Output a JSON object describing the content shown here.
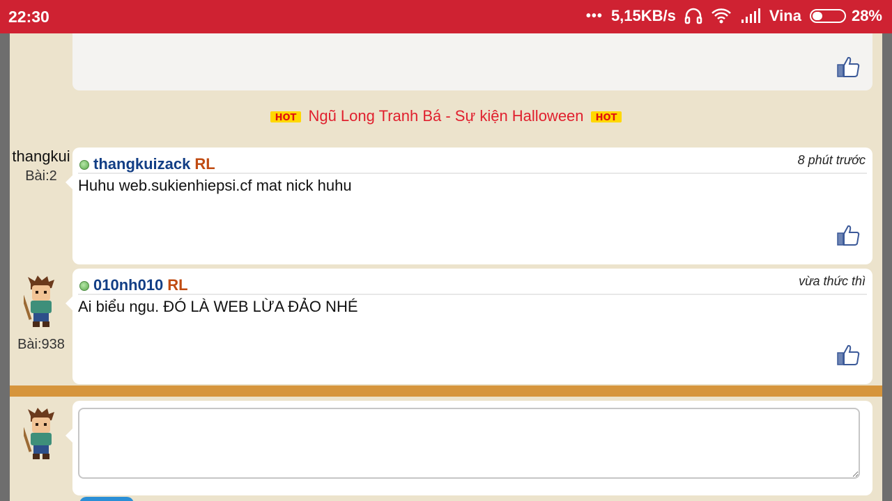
{
  "status_bar": {
    "time": "22:30",
    "network_speed": "5,15KB/s",
    "carrier": "Vina",
    "battery": "28%"
  },
  "hot_topic": {
    "badge": "HOT",
    "title": "Ngũ Long Tranh Bá - Sự kiện Halloween"
  },
  "posts": [
    {
      "author": "thangkuizack",
      "author_short": "thangkui",
      "post_count": "Bài:2",
      "role": "RL",
      "time": "8 phút trước",
      "content": "Huhu web.sukienhiepsi.cf mat nick huhu"
    },
    {
      "author": "010nh010",
      "post_count": "Bài:938",
      "role": "RL",
      "time": "vừa thức thì",
      "content": "Ai biểu ngu. ĐÓ LÀ WEB LỪA ĐẢO NHÉ"
    }
  ],
  "colors": {
    "status_bar": "#cf2232",
    "page_bg": "#ece3cc",
    "username": "#123e85",
    "role": "#c04b12",
    "hot": "#e0202e",
    "divider": "#d6953c"
  },
  "icons": [
    "headphones-icon",
    "wifi-icon",
    "signal-icon",
    "battery-icon",
    "like-icon",
    "hot-badge-icon",
    "online-dot-icon",
    "avatar-icon"
  ]
}
